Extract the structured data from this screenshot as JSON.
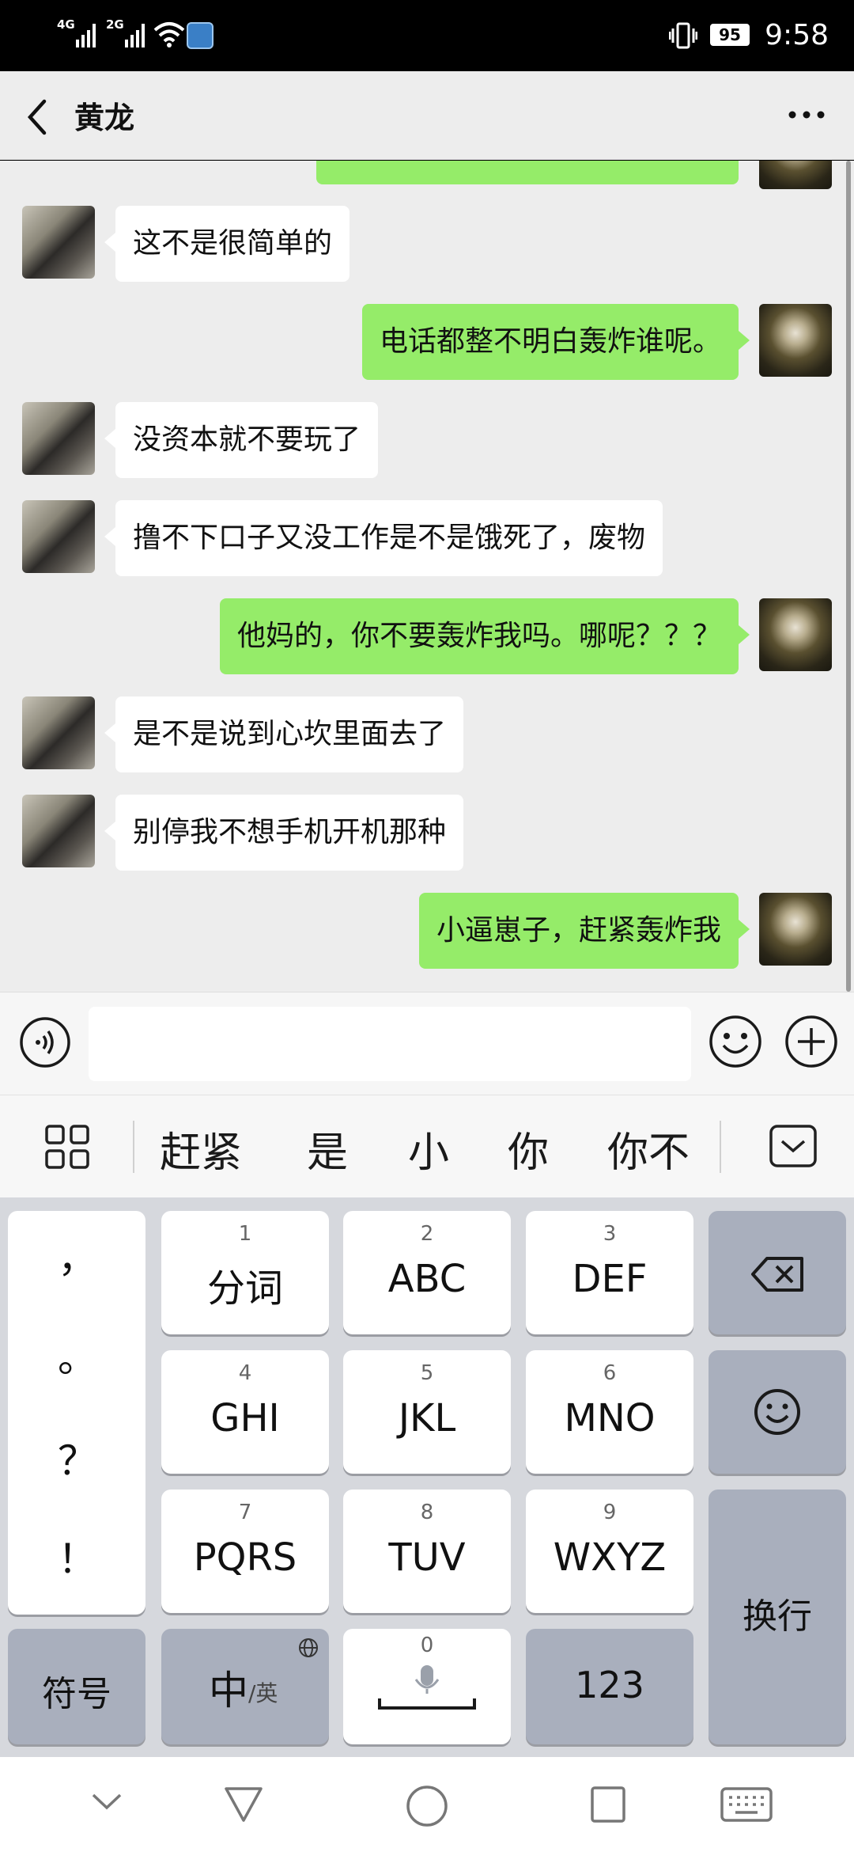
{
  "status_bar": {
    "signal1": "4G",
    "signal2": "2G",
    "battery": "95",
    "time": "9:58"
  },
  "header": {
    "title": "黄龙"
  },
  "messages": [
    {
      "side": "out",
      "text": "",
      "partial": true
    },
    {
      "side": "in",
      "text": "这不是很简单的"
    },
    {
      "side": "out",
      "text": "电话都整不明白轰炸谁呢。"
    },
    {
      "side": "in",
      "text": "没资本就不要玩了"
    },
    {
      "side": "in",
      "text": "撸不下口子又没工作是不是饿死了，废物"
    },
    {
      "side": "out",
      "text": "他妈的，你不要轰炸我吗。哪呢？？？"
    },
    {
      "side": "in",
      "text": "是不是说到心坎里面去了"
    },
    {
      "side": "in",
      "text": "别停我不想手机开机那种"
    },
    {
      "side": "out",
      "text": "小逼崽子，赶紧轰炸我"
    }
  ],
  "input": {
    "value": "",
    "placeholder": ""
  },
  "candidates": [
    "赶紧",
    "是",
    "小",
    "你",
    "你不"
  ],
  "keyboard": {
    "punctuation": [
      "，",
      "。",
      "？",
      "！"
    ],
    "keys": [
      {
        "num": "1",
        "label": "分词"
      },
      {
        "num": "2",
        "label": "ABC"
      },
      {
        "num": "3",
        "label": "DEF"
      },
      {
        "num": "4",
        "label": "GHI"
      },
      {
        "num": "5",
        "label": "JKL"
      },
      {
        "num": "6",
        "label": "MNO"
      },
      {
        "num": "7",
        "label": "PQRS"
      },
      {
        "num": "8",
        "label": "TUV"
      },
      {
        "num": "9",
        "label": "WXYZ"
      }
    ],
    "symbols_label": "符号",
    "lang_main": "中",
    "lang_alt": "/英",
    "space_num": "0",
    "num_label": "123",
    "enter_label": "换行"
  },
  "colors": {
    "chat_bg": "#ededed",
    "bubble_in": "#ffffff",
    "bubble_out": "#95ec69",
    "key_dark": "#a9afbd"
  }
}
